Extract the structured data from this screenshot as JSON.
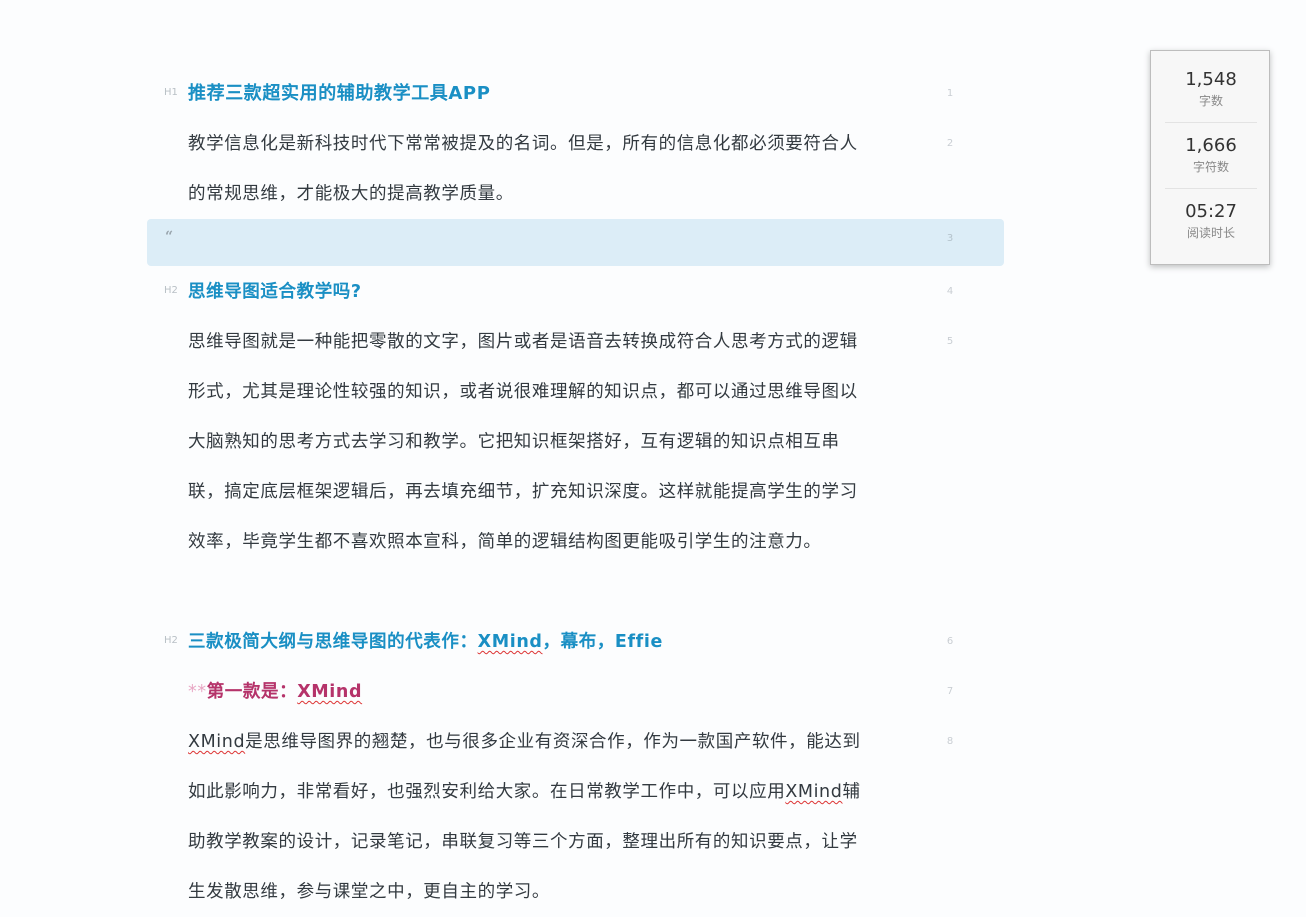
{
  "tags": {
    "h1": "H1",
    "h2": "H2",
    "quote": "“"
  },
  "doc": {
    "title": "推荐三款超实用的辅助教学工具APP",
    "intro_line1": "教学信息化是新科技时代下常常被提及的名词。但是，所有的信息化都必须要符合人",
    "intro_line2": "的常规思维，才能极大的提高教学质量。",
    "section1_heading": "思维导图适合教学吗?",
    "section1_lines": [
      "思维导图就是一种能把零散的文字，图片或者是语音去转换成符合人思考方式的逻辑",
      "形式，尤其是理论性较强的知识，或者说很难理解的知识点，都可以通过思维导图以",
      "大脑熟知的思考方式去学习和教学。它把知识框架搭好，互有逻辑的知识点相互串",
      "联，搞定底层框架逻辑后，再去填充细节，扩充知识深度。这样就能提高学生的学习",
      "效率，毕竟学生都不喜欢照本宣科，简单的逻辑结构图更能吸引学生的注意力。"
    ],
    "section2_heading_a": "三款极简大纲与思维导图的代表作：",
    "section2_heading_xmind": "XMind",
    "section2_heading_b": "，幕布，Effie",
    "item1_marker": "**",
    "item1_label": "第一款是：",
    "item1_name": "XMind",
    "item1_p1_a": "XMind",
    "item1_p1_b": "是思维导图界的翘楚，也与很多企业有资深合作，作为一款国产软件，能达到",
    "item1_p2_a": "如此影响力，非常看好，也强烈安利给大家。在日常教学工作中，可以应用",
    "item1_p2_b": "XMind",
    "item1_p2_c": "辅",
    "item1_p3": "助教学教案的设计，记录笔记，串联复习等三个方面，整理出所有的知识要点，让学",
    "item1_p4": "生发散思维，参与课堂之中，更自主的学习。"
  },
  "line_numbers": [
    "1",
    "2",
    "3",
    "4",
    "5",
    "6",
    "7",
    "8"
  ],
  "stats": {
    "words_value": "1,548",
    "words_label": "字数",
    "chars_value": "1,666",
    "chars_label": "字符数",
    "time_value": "05:27",
    "time_label": "阅读时长"
  }
}
